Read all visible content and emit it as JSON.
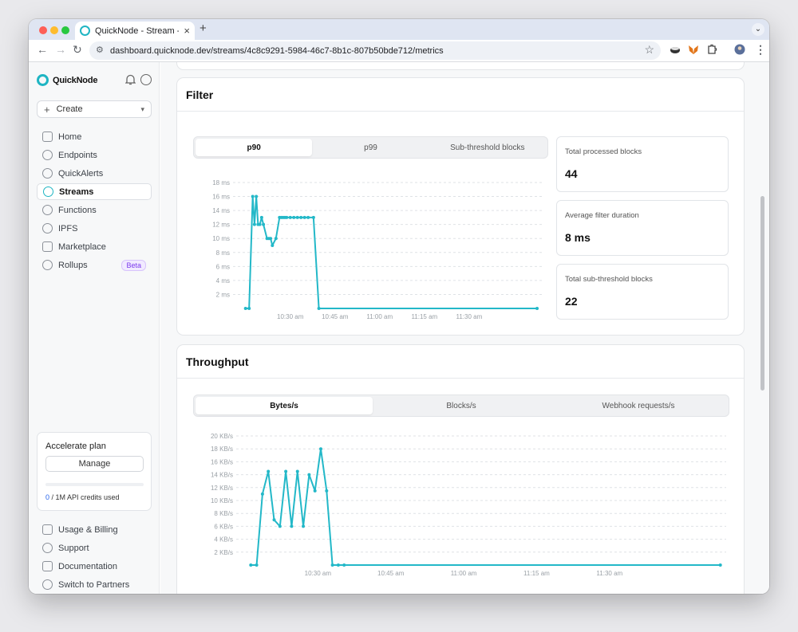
{
  "browser": {
    "tab_title": "QuickNode - Stream - Metrics",
    "url": "dashboard.quicknode.dev/streams/4c8c9291-5984-46c7-8b1c-807b50bde712/metrics"
  },
  "brand": {
    "name": "QuickNode"
  },
  "sidebar": {
    "create_label": "Create",
    "items": [
      {
        "label": "Home",
        "icon": "home-icon"
      },
      {
        "label": "Endpoints",
        "icon": "endpoints-icon"
      },
      {
        "label": "QuickAlerts",
        "icon": "quickalerts-icon"
      },
      {
        "label": "Streams",
        "icon": "streams-icon",
        "active": true
      },
      {
        "label": "Functions",
        "icon": "functions-icon"
      },
      {
        "label": "IPFS",
        "icon": "ipfs-icon"
      },
      {
        "label": "Marketplace",
        "icon": "marketplace-icon"
      },
      {
        "label": "Rollups",
        "icon": "rollups-icon",
        "badge": "Beta"
      }
    ],
    "plan": {
      "title": "Accelerate plan",
      "manage_label": "Manage",
      "credits_used": "0",
      "credits_rest": " / 1M API credits used"
    },
    "bottom_items": [
      {
        "label": "Usage & Billing",
        "icon": "billing-icon"
      },
      {
        "label": "Support",
        "icon": "support-icon"
      },
      {
        "label": "Documentation",
        "icon": "docs-icon"
      },
      {
        "label": "Switch to Partners",
        "icon": "partners-icon"
      }
    ]
  },
  "filter": {
    "title": "Filter",
    "tabs": [
      "p90",
      "p99",
      "Sub-threshold blocks"
    ],
    "active_tab": 0,
    "stats": [
      {
        "label": "Total processed blocks",
        "value": "44"
      },
      {
        "label": "Average filter duration",
        "value": "8 ms"
      },
      {
        "label": "Total sub-threshold blocks",
        "value": "22"
      }
    ]
  },
  "throughput": {
    "title": "Throughput",
    "tabs": [
      "Bytes/s",
      "Blocks/s",
      "Webhook requests/s"
    ],
    "active_tab": 0
  },
  "chart_data": [
    {
      "type": "line",
      "ylabels": [
        "18 ms",
        "16 ms",
        "14 ms",
        "12 ms",
        "10 ms",
        "8 ms",
        "6 ms",
        "4 ms",
        "2 ms"
      ],
      "yticks": [
        18,
        16,
        14,
        12,
        10,
        8,
        6,
        4,
        2
      ],
      "ylim": [
        0,
        18
      ],
      "xlim": [
        10.18,
        11.92
      ],
      "xticks": [
        10.5,
        10.75,
        11.0,
        11.25,
        11.5
      ],
      "xlabels": [
        "10:30 am",
        "10:45 am",
        "11:00 am",
        "11:15 am",
        "11:30 am"
      ],
      "color": "#23b8c8",
      "x": [
        10.25,
        10.27,
        10.29,
        10.3,
        10.31,
        10.32,
        10.33,
        10.34,
        10.35,
        10.37,
        10.38,
        10.39,
        10.4,
        10.42,
        10.44,
        10.45,
        10.46,
        10.47,
        10.48,
        10.5,
        10.52,
        10.54,
        10.56,
        10.58,
        10.6,
        10.63,
        10.66,
        11.88
      ],
      "y": [
        0,
        0,
        16,
        12,
        16,
        12,
        12,
        13,
        12,
        10,
        10,
        10,
        9,
        10,
        13,
        13,
        13,
        13,
        13,
        13,
        13,
        13,
        13,
        13,
        13,
        13,
        0,
        0
      ]
    },
    {
      "type": "line",
      "ylabels": [
        "20 KB/s",
        "18 KB/s",
        "16 KB/s",
        "14 KB/s",
        "12 KB/s",
        "10 KB/s",
        "8 KB/s",
        "6 KB/s",
        "4 KB/s",
        "2 KB/s"
      ],
      "yticks": [
        20,
        18,
        16,
        14,
        12,
        10,
        8,
        6,
        4,
        2
      ],
      "ylim": [
        0,
        20
      ],
      "xlim": [
        10.22,
        11.9
      ],
      "xticks": [
        10.5,
        10.75,
        11.0,
        11.25,
        11.5
      ],
      "xlabels": [
        "10:30 am",
        "10:45 am",
        "11:00 am",
        "11:15 am",
        "11:30 am"
      ],
      "color": "#23b8c8",
      "x": [
        10.27,
        10.29,
        10.31,
        10.33,
        10.35,
        10.37,
        10.39,
        10.41,
        10.43,
        10.45,
        10.47,
        10.49,
        10.51,
        10.53,
        10.55,
        10.57,
        10.59,
        11.88
      ],
      "y": [
        0,
        0,
        11,
        14.5,
        7,
        6,
        14.5,
        6,
        14.5,
        6,
        14,
        11.5,
        18,
        11.5,
        0,
        0,
        0,
        0
      ]
    }
  ]
}
